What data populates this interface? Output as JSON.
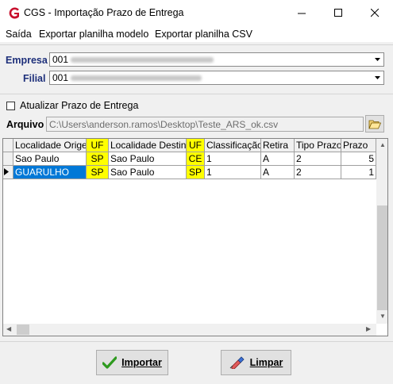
{
  "window": {
    "title": "CGS - Importação Prazo de Entrega",
    "controls": [
      "minimize",
      "maximize",
      "close"
    ]
  },
  "menu": {
    "items": [
      "Saída",
      "Exportar planilha modelo",
      "Exportar planilha CSV"
    ]
  },
  "form": {
    "empresa_label": "Empresa",
    "empresa_value": "001",
    "filial_label": "Filial",
    "filial_value": "001",
    "checkbox_label": "Atualizar Prazo de Entrega",
    "checkbox_checked": false,
    "arquivo_label": "Arquivo",
    "arquivo_value": "C:\\Users\\anderson.ramos\\Desktop\\Teste_ARS_ok.csv"
  },
  "grid": {
    "columns": [
      "Localidade Origem",
      "UF",
      "Localidade Destino",
      "UF",
      "Classificação",
      "Retira",
      "Tipo Prazo",
      "Prazo"
    ],
    "rows": [
      [
        "Sao Paulo",
        "SP",
        "Sao Paulo",
        "CE",
        "1",
        "A",
        "2",
        "5"
      ],
      [
        "GUARULHO",
        "SP",
        "Sao Paulo",
        "SP",
        "1",
        "A",
        "2",
        "1"
      ]
    ],
    "current_row": 1,
    "highlight_color": "#ffff00",
    "selection_color": "#0078d7"
  },
  "buttons": {
    "import_label": "Importar",
    "clear_label": "Limpar"
  }
}
